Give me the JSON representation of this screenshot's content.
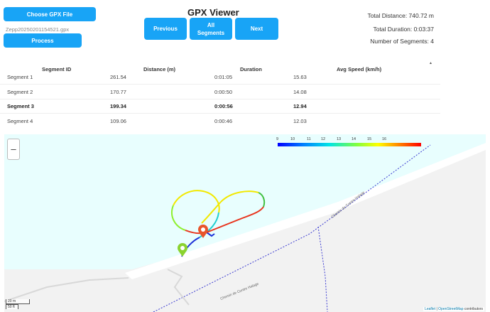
{
  "app": {
    "title": "GPX Viewer",
    "choose_button": "Choose GPX File",
    "file_name": "Zepp20250201154521.gpx",
    "process_button": "Process",
    "prev_button": "Previous",
    "all_button": "All Segments",
    "next_button": "Next"
  },
  "stats": {
    "total_distance": "Total Distance: 740.72 m",
    "total_duration": "Total Duration: 0:03:37",
    "num_segments": "Number of Segments: 4"
  },
  "table": {
    "headers": [
      "Segment ID",
      "Distance (m)",
      "Duration",
      "Avg Speed (km/h)"
    ],
    "sort_icon": "▲",
    "rows": [
      {
        "id": "Segment 1",
        "distance": "261.54",
        "duration": "0:01:05",
        "speed": "15.63",
        "selected": false
      },
      {
        "id": "Segment 2",
        "distance": "170.77",
        "duration": "0:00:50",
        "speed": "14.08",
        "selected": false
      },
      {
        "id": "Segment 3",
        "distance": "199.34",
        "duration": "0:00:56",
        "speed": "12.94",
        "selected": true
      },
      {
        "id": "Segment 4",
        "distance": "109.06",
        "duration": "0:00:46",
        "speed": "12.03",
        "selected": false
      }
    ]
  },
  "map": {
    "zoom_minus": "–",
    "legend_ticks": [
      "9",
      "10",
      "11",
      "12",
      "13",
      "14",
      "15",
      "16"
    ],
    "road_label_1": "Chemin de Contre-Halage",
    "road_label_2": "Chemin de Contre Halage",
    "scale_m": "20 m",
    "scale_ft": "50 ft",
    "attribution_leaflet": "Leaflet",
    "attribution_osm": "OpenStreetMap",
    "attribution_suffix": "contributors",
    "start_marker_icon": "start-marker-icon",
    "end_marker_icon": "end-marker-icon"
  },
  "colors": {
    "button": "#18a4f6",
    "map_water": "#e8fefe",
    "route_blue": "#1a2fd8",
    "route_yellow": "#f2e800",
    "route_red": "#e8331c"
  }
}
